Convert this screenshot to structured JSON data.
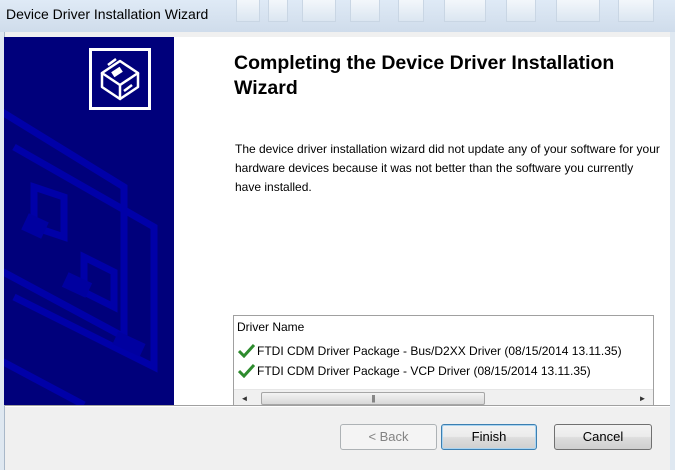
{
  "window": {
    "title": "Device Driver Installation Wizard"
  },
  "heading": "Completing the Device Driver Installation Wizard",
  "message": "The device driver installation wizard did not update any of your software for your hardware devices because it was not better than the software you currently have installed.",
  "driver_list": {
    "column_header": "Driver Name",
    "rows": [
      {
        "name": "FTDI CDM Driver Package - Bus/D2XX Driver (08/15/2014 13.11.35)",
        "status_icon": "check-icon"
      },
      {
        "name": "FTDI CDM Driver Package - VCP Driver (08/15/2014 13.11.35)",
        "status_icon": "check-icon"
      }
    ],
    "scroll_left": "◄",
    "scroll_right": "►",
    "thumb_grip": "|||"
  },
  "buttons": {
    "back": "< Back",
    "finish": "Finish",
    "cancel": "Cancel"
  },
  "colors": {
    "banner": "#00007b",
    "check": "#2e8b2e"
  }
}
